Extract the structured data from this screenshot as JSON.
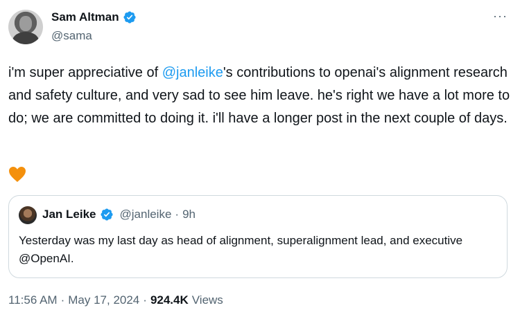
{
  "author": {
    "display_name": "Sam Altman",
    "handle": "@sama",
    "verified": true
  },
  "more_glyph": "···",
  "tweet": {
    "text_before_mention": "i'm super appreciative of ",
    "mention": "@janleike",
    "text_after_mention": "'s contributions to openai's alignment research and safety culture, and very sad to see him leave. he's right we have a lot more to do; we are committed to doing it. i'll have a longer post in the next couple of days.",
    "emoji": "orange-heart"
  },
  "quoted_tweet": {
    "display_name": "Jan Leike",
    "handle": "@janleike",
    "separator": "·",
    "time": "9h",
    "text": "Yesterday was my last day as head of alignment, superalignment lead, and executive @OpenAI."
  },
  "meta": {
    "time": "11:56 AM",
    "sep1": "·",
    "date": "May 17, 2024",
    "sep2": "·",
    "views_count": "924.4K",
    "views_label": "Views"
  },
  "colors": {
    "link": "#1d9bf0",
    "secondary_text": "#536471",
    "primary_text": "#0f1419",
    "border": "#cfd9de",
    "heart": "#f4900c"
  }
}
